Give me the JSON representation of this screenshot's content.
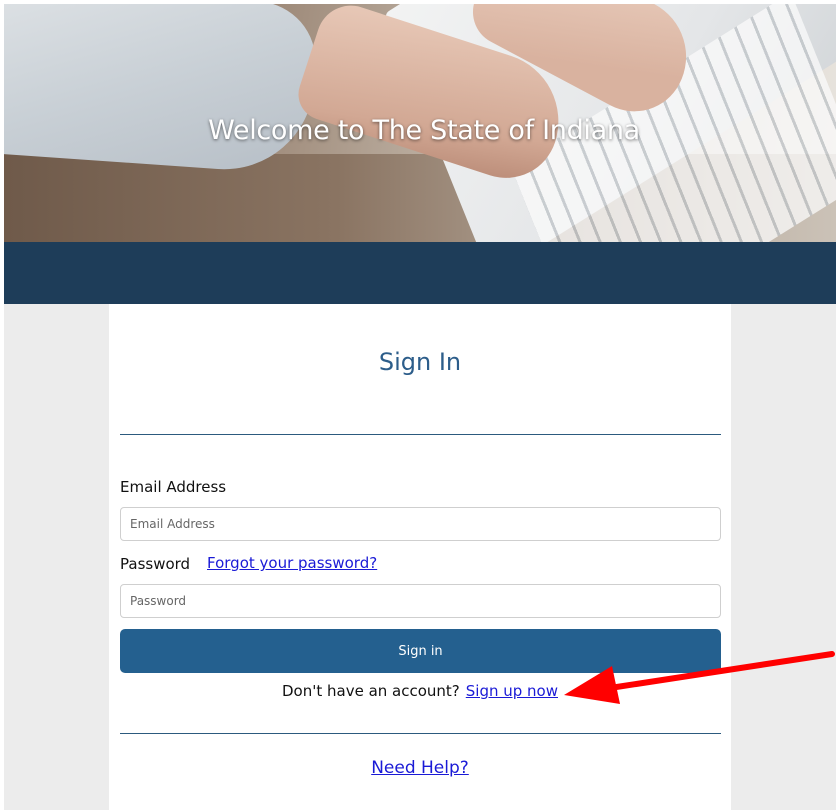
{
  "hero": {
    "title": "Welcome to The State of Indiana"
  },
  "signin": {
    "heading": "Sign In",
    "email_label": "Email Address",
    "email_placeholder": "Email Address",
    "email_value": "",
    "password_label": "Password",
    "forgot_link": "Forgot your password?",
    "password_placeholder": "Password",
    "password_value": "",
    "submit_label": "Sign in",
    "no_account_text": "Don't have an account?",
    "signup_link": "Sign up now",
    "help_link": "Need Help?"
  },
  "colors": {
    "page_bg": "#ececec",
    "band": "#1e3d59",
    "heading": "#2c5d8a",
    "button": "#24608f",
    "link": "#1a1ad6",
    "annotation_arrow": "#ff0000"
  },
  "annotation": {
    "icon": "arrow-left-icon"
  }
}
